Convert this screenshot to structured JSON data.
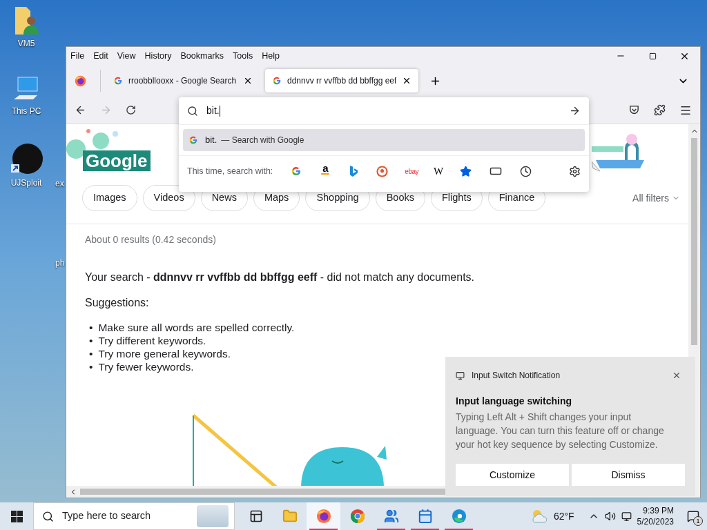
{
  "desktop_icons": [
    {
      "label": "VM5",
      "kind": "user-folder"
    },
    {
      "label": "This PC",
      "kind": "computer"
    },
    {
      "label": "UJSploit",
      "kind": "shortcut"
    }
  ],
  "desktop_partial_labels": [
    "ex",
    "ph"
  ],
  "browser": {
    "menu": [
      "File",
      "Edit",
      "View",
      "History",
      "Bookmarks",
      "Tools",
      "Help"
    ],
    "tabs": [
      {
        "title": "rroobbllooxx - Google Search",
        "selected": false
      },
      {
        "title": "ddnnvv rr vvffbb dd bbffgg eef",
        "selected": true
      }
    ],
    "nav_buttons": [
      {
        "kind": "back",
        "disabled": false
      },
      {
        "kind": "forward",
        "disabled": true
      },
      {
        "kind": "reload",
        "disabled": false
      }
    ],
    "address_dropdown": {
      "value": "bit.",
      "suggestions": [
        {
          "query": "bit.",
          "action": "— Search with Google",
          "selected": true
        }
      ],
      "engines_label": "This time, search with:",
      "engines": [
        {
          "kind": "google"
        },
        {
          "kind": "amazon",
          "glyph": "a"
        },
        {
          "kind": "bing"
        },
        {
          "kind": "duckduckgo"
        },
        {
          "kind": "ebay",
          "glyph": "ebay"
        },
        {
          "kind": "wikipedia",
          "glyph": "W"
        },
        {
          "kind": "bookmarks"
        },
        {
          "kind": "tabs"
        },
        {
          "kind": "history"
        }
      ]
    },
    "page": {
      "doodle_text": "Google",
      "filter_chips": [
        "Images",
        "Videos",
        "News",
        "Maps",
        "Shopping",
        "Books",
        "Flights",
        "Finance"
      ],
      "all_filters": "All filters",
      "results_stats": "About 0 results (0.42 seconds)",
      "no_match": "Your search - **ddnnvv rr vvffbb dd bbffgg eeff** - did not match any documents.",
      "suggestions_heading": "Suggestions:",
      "suggestions": [
        {
          "marker": "•",
          "text": "Make sure all words are spelled correctly."
        },
        {
          "marker": "•",
          "text": "Try different keywords."
        },
        {
          "marker": "•",
          "text": "Try more general keywords."
        },
        {
          "marker": "•",
          "text": "Try fewer keywords."
        }
      ]
    }
  },
  "notification": {
    "app": "Input Switch Notification",
    "title": "Input language switching",
    "body": "Typing Left Alt + Shift changes your input language. You can turn this feature off or change your hot key sequence by selecting Customize.",
    "buttons": [
      "Customize",
      "Dismiss"
    ]
  },
  "taskbar": {
    "search_placeholder": "Type here to search",
    "apps": [
      {
        "kind": "task-view",
        "running": false,
        "active": false
      },
      {
        "kind": "explorer",
        "running": false,
        "active": false
      },
      {
        "kind": "firefox",
        "running": true,
        "active": true
      },
      {
        "kind": "chrome",
        "running": false,
        "active": false
      },
      {
        "kind": "people",
        "running": true,
        "active": false
      },
      {
        "kind": "calendar",
        "running": true,
        "active": false
      },
      {
        "kind": "edge",
        "running": true,
        "active": false
      }
    ],
    "weather": "62°F",
    "time": "9:39 PM",
    "date": "5/20/2023",
    "notification_count": "1"
  }
}
